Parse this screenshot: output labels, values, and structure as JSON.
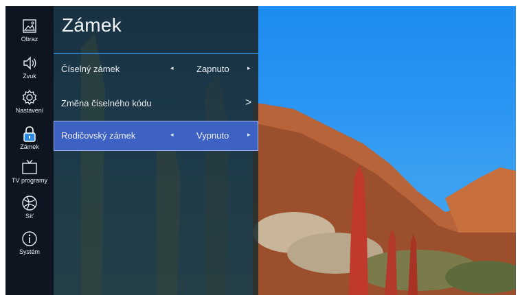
{
  "sidebar": {
    "items": [
      {
        "label": "Obraz",
        "icon": "picture-icon"
      },
      {
        "label": "Zvuk",
        "icon": "speaker-icon"
      },
      {
        "label": "Nastavení",
        "icon": "gear-icon"
      },
      {
        "label": "Zámek",
        "icon": "lock-icon",
        "active": true
      },
      {
        "label": "TV programy",
        "icon": "tv-icon"
      },
      {
        "label": "Síť",
        "icon": "globe-icon"
      },
      {
        "label": "Systém",
        "icon": "info-icon"
      }
    ]
  },
  "panel": {
    "title": "Zámek",
    "rows": [
      {
        "label": "Číselný zámek",
        "value": "Zapnuto",
        "left_arrow": "◂",
        "right_arrow": "▸"
      },
      {
        "label": "Změna číselného kódu",
        "chevron": ">"
      },
      {
        "label": "Rodičovský zámek",
        "value": "Vypnuto",
        "left_arrow": "◂",
        "right_arrow": "▸",
        "selected": true
      }
    ]
  },
  "colors": {
    "rail_bg": "#0c1520",
    "accent": "#2f78b8",
    "selected_bg": "#3d62c4",
    "sky": "#1e8cf0"
  }
}
